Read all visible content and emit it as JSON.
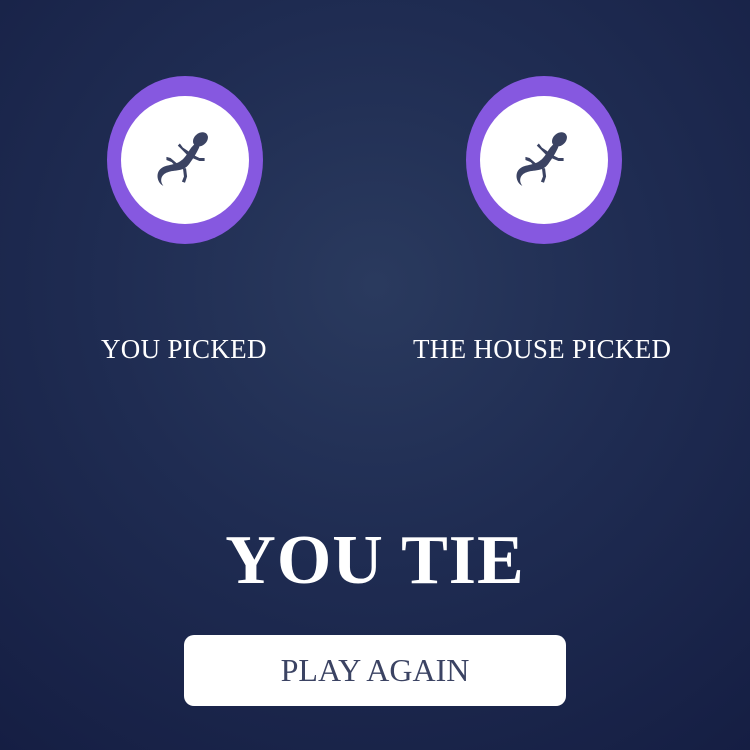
{
  "player": {
    "label": "YOU PICKED",
    "choice_icon": "lizard-icon"
  },
  "house": {
    "label": "THE HOUSE PICKED",
    "choice_icon": "lizard-icon"
  },
  "result": {
    "text": "YOU TIE"
  },
  "play_again": {
    "label": "PLAY AGAIN"
  },
  "colors": {
    "background": "#1f2c52",
    "choice_ring": "#8658e0",
    "icon": "#3b4363",
    "text": "#ffffff"
  }
}
